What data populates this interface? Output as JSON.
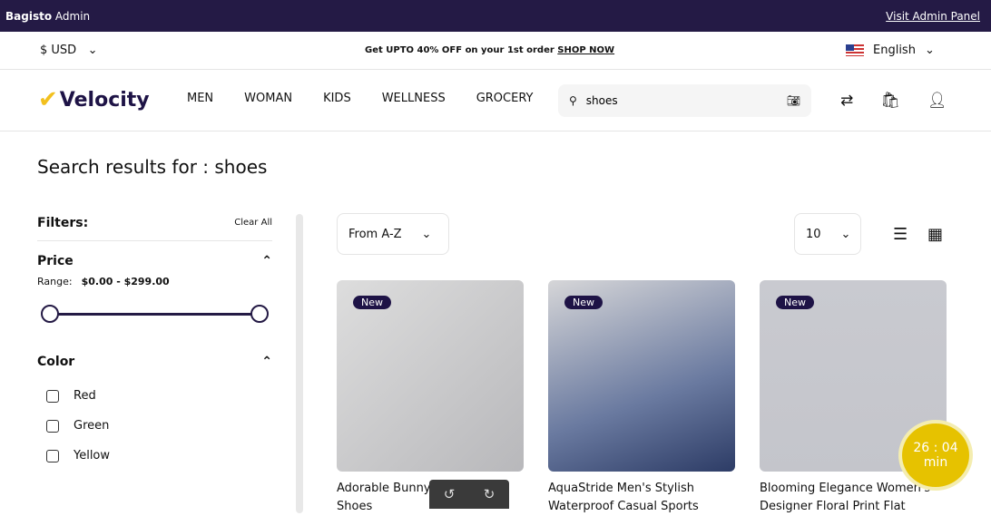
{
  "admin_bar": {
    "brand_bold": "Bagisto",
    "brand_rest": " Admin",
    "link": "Visit Admin Panel"
  },
  "promo": {
    "currency": "$ USD",
    "text": "Get UPTO 40% OFF on your 1st order ",
    "link": "SHOP NOW",
    "language": "English"
  },
  "header": {
    "logo": "Velocity",
    "nav": [
      "MEN",
      "WOMAN",
      "KIDS",
      "WELLNESS",
      "GROCERY"
    ],
    "search_value": "shoes"
  },
  "page_title": "Search results for : shoes",
  "filters": {
    "title": "Filters:",
    "clear": "Clear All",
    "price": {
      "label": "Price",
      "range_label": "Range:",
      "range_value": "$0.00 - $299.00",
      "min": 0,
      "max": 299
    },
    "color": {
      "label": "Color",
      "options": [
        "Red",
        "Green",
        "Yellow"
      ]
    }
  },
  "toolbar": {
    "sort": "From A-Z",
    "per_page": "10",
    "view": "grid"
  },
  "products": [
    {
      "badge": "New",
      "title": "Adorable Bunny-Hop Baby Shoes"
    },
    {
      "badge": "New",
      "title": "AquaStride Men's Stylish Waterproof Casual Sports"
    },
    {
      "badge": "New",
      "title": "Blooming Elegance Women's Designer Floral Print Flat"
    }
  ],
  "timer": {
    "time": "26 : 04",
    "unit": "min"
  }
}
